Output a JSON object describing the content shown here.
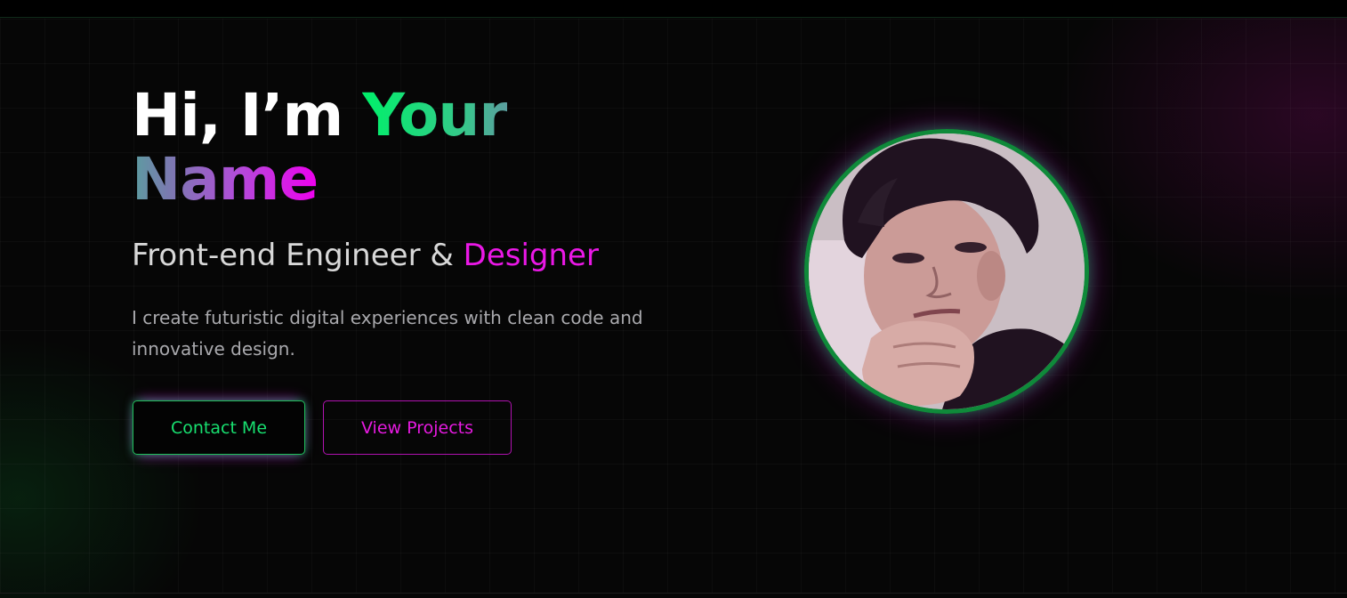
{
  "hero": {
    "greeting": "Hi, I’m ",
    "name_part1": "Your",
    "name_part2": "Name",
    "role_main": "Front-end Engineer & ",
    "role_accent": "Designer",
    "description": "I create futuristic digital experiences with clean code and innovative design.",
    "contact_button": "Contact Me",
    "projects_button": "View Projects"
  },
  "colors": {
    "background": "#060606",
    "neon_green": "#00f06a",
    "neon_magenta": "#ea18e6",
    "avatar_ring": "#0f8a3a"
  },
  "icons": {
    "avatar": "profile-photo"
  }
}
